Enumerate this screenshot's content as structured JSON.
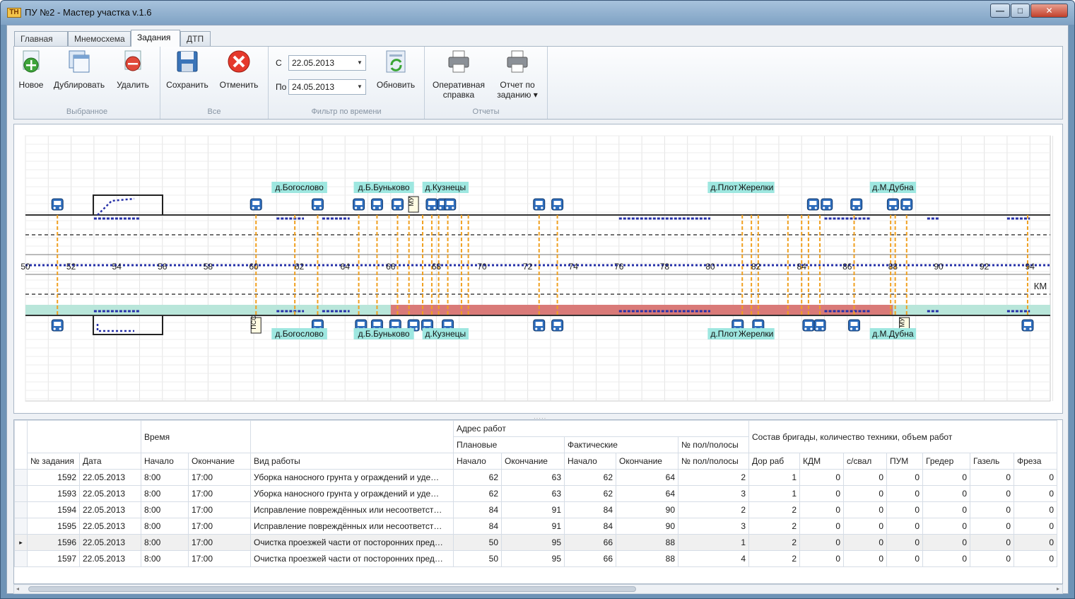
{
  "window": {
    "title": "ПУ №2 - Мастер участка v.1.6",
    "icon": "ТН",
    "buttons": {
      "minimize": "—",
      "maximize": "□",
      "close": "✕"
    }
  },
  "tabs": [
    "Главная",
    "Мнемосхема",
    "Задания",
    "ДТП"
  ],
  "active_tab": "Задания",
  "ribbon": {
    "groups": {
      "selected": "Выбранное",
      "all": "Все",
      "filter": "Фильтр по времени",
      "reports": "Отчеты"
    },
    "buttons": {
      "new": "Новое",
      "duplicate": "Дублировать",
      "delete": "Удалить",
      "save": "Сохранить",
      "cancel": "Отменить",
      "refresh": "Обновить",
      "operative_1": "Оперативная",
      "operative_2": "справка",
      "report_1": "Отчет по",
      "report_2": "заданию ▾"
    },
    "filter": {
      "from_label": "С",
      "from_value": "22.05.2013",
      "to_label": "По",
      "to_value": "24.05.2013",
      "dd": "▼"
    }
  },
  "diagram": {
    "km_unit": "КМ",
    "km_ticks": [
      "50",
      "52",
      "54",
      "56",
      "58",
      "60",
      "62",
      "64",
      "66",
      "68",
      "70",
      "72",
      "74",
      "76",
      "78",
      "80",
      "82",
      "84",
      "86",
      "88",
      "90",
      "92",
      "94"
    ],
    "stops_top": [
      {
        "km": 51.4
      },
      {
        "km": 60.1
      },
      {
        "km": 62.8
      },
      {
        "km": 64.6
      },
      {
        "km": 65.4
      },
      {
        "km": 66.3
      },
      {
        "km": 67.8
      },
      {
        "km": 68.3
      },
      {
        "km": 68.6
      },
      {
        "km": 72.5
      },
      {
        "km": 73.3
      },
      {
        "km": 84.5
      },
      {
        "km": 85.1
      },
      {
        "km": 86.4
      },
      {
        "km": 88.0
      },
      {
        "km": 88.6
      }
    ],
    "stops_bottom": [
      {
        "km": 51.4
      },
      {
        "km": 62.8
      },
      {
        "km": 64.7
      },
      {
        "km": 65.4
      },
      {
        "km": 66.2
      },
      {
        "km": 67.0
      },
      {
        "km": 67.6
      },
      {
        "km": 68.5
      },
      {
        "km": 72.5
      },
      {
        "km": 73.3
      },
      {
        "km": 81.2
      },
      {
        "km": 82.1
      },
      {
        "km": 84.3
      },
      {
        "km": 84.8
      },
      {
        "km": 86.3
      },
      {
        "km": 93.9
      }
    ],
    "signs": {
      "mu": "МУ",
      "pss": "ПСС"
    },
    "labels_top": [
      {
        "text": "д.Богослово",
        "km": 62.0
      },
      {
        "text": "д.Б.Буньково",
        "km": 65.7
      },
      {
        "text": "д.Кузнецы",
        "km": 68.4
      },
      {
        "text": "д.Плотава",
        "km": 80.9
      },
      {
        "text": "Жерелки",
        "km": 82.0
      },
      {
        "text": "д.М.Дубна",
        "km": 88.0
      }
    ],
    "labels_bottom": [
      {
        "text": "д.Богослово",
        "km": 62.0
      },
      {
        "text": "д.Б.Буньково",
        "km": 65.7
      },
      {
        "text": "д.Кузнецы",
        "km": 68.4
      },
      {
        "text": "д.Плотава",
        "km": 80.9
      },
      {
        "text": "Жерелки",
        "km": 82.0
      },
      {
        "text": "д.М.Дубна",
        "km": 88.0
      }
    ],
    "work_zone": {
      "from_km": 66,
      "to_km": 88,
      "color": "#d97a78"
    },
    "lane_color": "#b9e6da",
    "dashed_orange_km": [
      51.4,
      60.1,
      61.8,
      62.8,
      64.6,
      65.4,
      66.3,
      66.8,
      67.4,
      67.8,
      68.1,
      68.5,
      69.1,
      69.4,
      72.5,
      73.3,
      81.4,
      81.8,
      82.1,
      83.4,
      84.0,
      84.3,
      84.8,
      86.3,
      87.9,
      88.1,
      88.6,
      93.9
    ]
  },
  "table": {
    "group_headers": {
      "time": "Время",
      "address": "Адрес работ",
      "planned": "Плановые",
      "actual": "Фактические",
      "lane_top": "№ пол/полосы",
      "brigade": "Состав бригады, количество техники, объем работ"
    },
    "columns": [
      "№ задания",
      "Дата",
      "Начало",
      "Окончание",
      "Вид работы",
      "Начало",
      "Окончание",
      "Начало",
      "Окончание",
      "№ пол/полосы",
      "Дор раб",
      "КДМ",
      "с/свал",
      "ПУМ",
      "Гредер",
      "Газель",
      "Фреза"
    ],
    "selected_marker": "▸",
    "rows": [
      {
        "id": "1592",
        "date": "22.05.2013",
        "start": "8:00",
        "end": "17:00",
        "work": "Уборка наносного грунта у ограждений и уде…",
        "p_start": "62",
        "p_end": "63",
        "f_start": "62",
        "f_end": "64",
        "lane": "2",
        "dor": "1",
        "kdm": "0",
        "sval": "0",
        "pum": "0",
        "greder": "0",
        "gazel": "0",
        "freza": "0"
      },
      {
        "id": "1593",
        "date": "22.05.2013",
        "start": "8:00",
        "end": "17:00",
        "work": "Уборка наносного грунта у ограждений и уде…",
        "p_start": "62",
        "p_end": "63",
        "f_start": "62",
        "f_end": "64",
        "lane": "3",
        "dor": "1",
        "kdm": "0",
        "sval": "0",
        "pum": "0",
        "greder": "0",
        "gazel": "0",
        "freza": "0"
      },
      {
        "id": "1594",
        "date": "22.05.2013",
        "start": "8:00",
        "end": "17:00",
        "work": "Исправление повреждённых или несоответст…",
        "p_start": "84",
        "p_end": "91",
        "f_start": "84",
        "f_end": "90",
        "lane": "2",
        "dor": "2",
        "kdm": "0",
        "sval": "0",
        "pum": "0",
        "greder": "0",
        "gazel": "0",
        "freza": "0"
      },
      {
        "id": "1595",
        "date": "22.05.2013",
        "start": "8:00",
        "end": "17:00",
        "work": "Исправление повреждённых или несоответст…",
        "p_start": "84",
        "p_end": "91",
        "f_start": "84",
        "f_end": "90",
        "lane": "3",
        "dor": "2",
        "kdm": "0",
        "sval": "0",
        "pum": "0",
        "greder": "0",
        "gazel": "0",
        "freza": "0"
      },
      {
        "id": "1596",
        "date": "22.05.2013",
        "start": "8:00",
        "end": "17:00",
        "work": "Очистка проезжей части от посторонних пред…",
        "p_start": "50",
        "p_end": "95",
        "f_start": "66",
        "f_end": "88",
        "lane": "1",
        "dor": "2",
        "kdm": "0",
        "sval": "0",
        "pum": "0",
        "greder": "0",
        "gazel": "0",
        "freza": "0",
        "selected": true
      },
      {
        "id": "1597",
        "date": "22.05.2013",
        "start": "8:00",
        "end": "17:00",
        "work": "Очистка проезжей части от посторонних пред…",
        "p_start": "50",
        "p_end": "95",
        "f_start": "66",
        "f_end": "88",
        "lane": "4",
        "dor": "2",
        "kdm": "0",
        "sval": "0",
        "pum": "0",
        "greder": "0",
        "gazel": "0",
        "freza": "0"
      }
    ]
  },
  "scrollbar": {
    "left": "◂",
    "right": "▸"
  }
}
